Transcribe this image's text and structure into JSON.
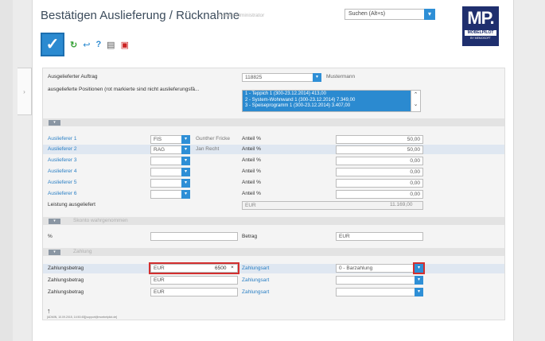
{
  "window": {
    "title": "Bestätigen Auslieferung / Rücknahme",
    "user": "Systemadministrator",
    "search_placeholder": "Suchen (Alt+s)"
  },
  "logo": {
    "main": "MP.",
    "sub": "MÖBELPILOT",
    "tiny": "BY MEMOSOFT"
  },
  "toolbar": {
    "ok": "✓",
    "refresh": "↻",
    "back": "↩",
    "help": "?",
    "print": "▤",
    "pdf": "▣"
  },
  "auftrag": {
    "label": "Ausgelieferter Auftrag",
    "number": "118825",
    "customer": "Mustermann",
    "positions_label": "ausgelieferte Positionen (rot markierte sind nicht auslieferungsfä...",
    "positions": [
      "1 - Teppich 1 (300-23.12.2014) 413,00",
      "2 - System-Wohnwand 1 (300-23.12.2014) 7.349,00",
      "3 - Speiseprogramm 1 (300-23.12.2014) 3.407,00"
    ]
  },
  "auslieferer": {
    "rows": [
      {
        "label": "Auslieferer 1",
        "code": "FIS",
        "name": "Gunther Fricke",
        "anteil_label": "Anteil %",
        "anteil": "50,00"
      },
      {
        "label": "Auslieferer 2",
        "code": "RAG",
        "name": "Jan Recht",
        "anteil_label": "Anteil %",
        "anteil": "50,00"
      },
      {
        "label": "Auslieferer 3",
        "code": "",
        "name": "",
        "anteil_label": "Anteil %",
        "anteil": "0,00"
      },
      {
        "label": "Auslieferer 4",
        "code": "",
        "name": "",
        "anteil_label": "Anteil %",
        "anteil": "0,00"
      },
      {
        "label": "Auslieferer 5",
        "code": "",
        "name": "",
        "anteil_label": "Anteil %",
        "anteil": "0,00"
      },
      {
        "label": "Auslieferer 6",
        "code": "",
        "name": "",
        "anteil_label": "Anteil %",
        "anteil": "0,00"
      }
    ],
    "leistung_label": "Leistung ausgeliefert",
    "leistung_currency": "EUR",
    "leistung_value": "11.169,00"
  },
  "skonto": {
    "section_title": "Skonto wahrgenommen",
    "percent_label": "%",
    "betrag_label": "Betrag",
    "betrag_currency": "EUR"
  },
  "zahlung": {
    "section_title": "Zahlung",
    "rows": [
      {
        "label": "Zahlungsbetrag",
        "currency": "EUR",
        "value": "6500",
        "art_label": "Zahlungsart",
        "art": "0 - Barzahlung"
      },
      {
        "label": "Zahlungsbetrag",
        "currency": "EUR",
        "value": "",
        "art_label": "Zahlungsart",
        "art": ""
      },
      {
        "label": "Zahlungsbetrag",
        "currency": "EUR",
        "value": "",
        "art_label": "Zahlungsart",
        "art": ""
      }
    ]
  },
  "footer": {
    "arrow": "↑",
    "text": "[ADMIN, 10.09.2015, 14:50:45][support@moebelpilot.de]"
  }
}
